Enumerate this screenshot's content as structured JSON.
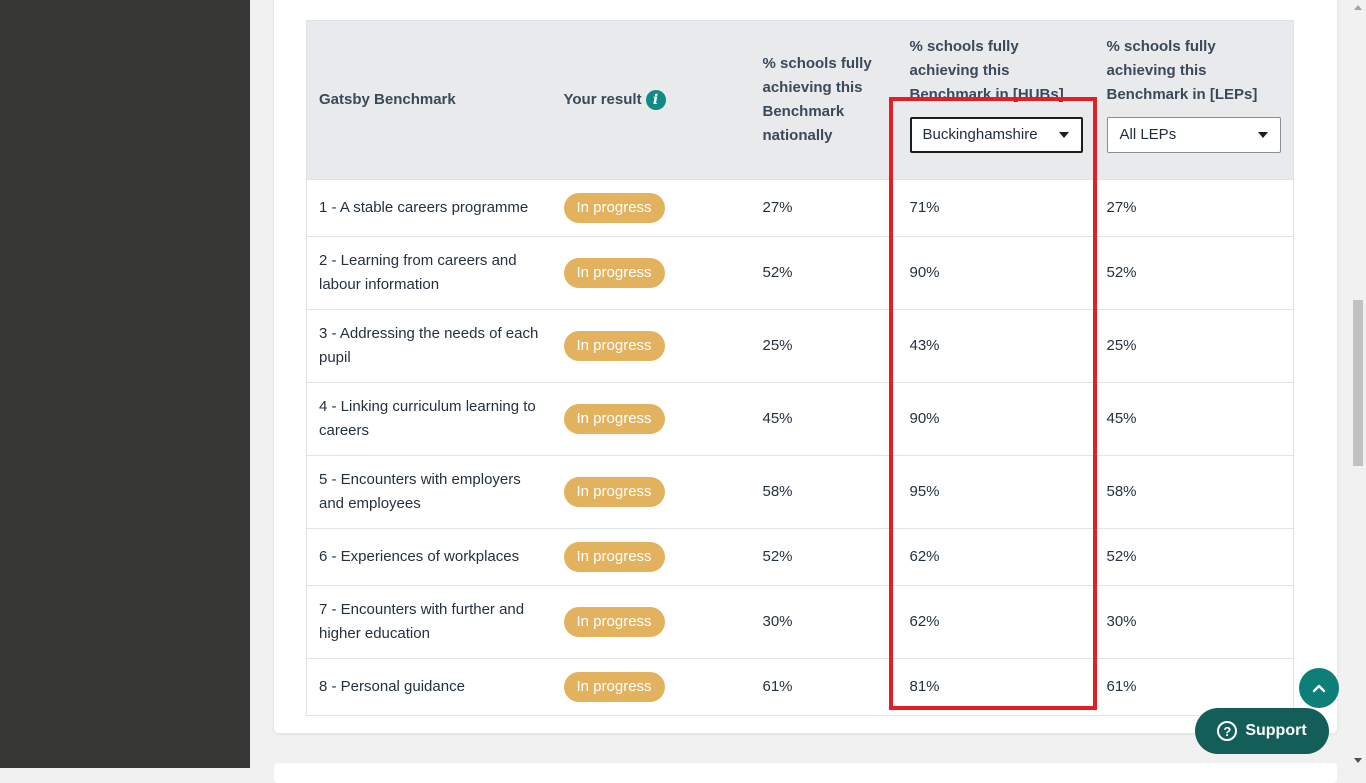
{
  "table": {
    "headers": {
      "benchmark": "Gatsby Benchmark",
      "result": "Your result",
      "national": "% schools fully achieving this Benchmark nationally",
      "hubs": "% schools fully achieving this Benchmark in [HUBs]",
      "leps": "% schools fully achieving this Benchmark in [LEPs]"
    },
    "hub_select_value": "Buckinghamshire",
    "lep_select_value": "All LEPs",
    "info_icon_glyph": "i",
    "rows": [
      {
        "benchmark": "1 - A stable careers programme",
        "result": "In progress",
        "national": "27%",
        "hub": "71%",
        "lep": "27%"
      },
      {
        "benchmark": "2 - Learning from careers and labour information",
        "result": "In progress",
        "national": "52%",
        "hub": "90%",
        "lep": "52%"
      },
      {
        "benchmark": "3 - Addressing the needs of each pupil",
        "result": "In progress",
        "national": "25%",
        "hub": "43%",
        "lep": "25%"
      },
      {
        "benchmark": "4 - Linking curriculum learning to careers",
        "result": "In progress",
        "national": "45%",
        "hub": "90%",
        "lep": "45%"
      },
      {
        "benchmark": "5 - Encounters with employers and employees",
        "result": "In progress",
        "national": "58%",
        "hub": "95%",
        "lep": "58%"
      },
      {
        "benchmark": "6 - Experiences of workplaces",
        "result": "In progress",
        "national": "52%",
        "hub": "62%",
        "lep": "52%"
      },
      {
        "benchmark": "7 - Encounters with further and higher education",
        "result": "In progress",
        "national": "30%",
        "hub": "62%",
        "lep": "30%"
      },
      {
        "benchmark": "8 - Personal guidance",
        "result": "In progress",
        "national": "61%",
        "hub": "81%",
        "lep": "61%"
      }
    ]
  },
  "buttons": {
    "support_label": "Support",
    "support_icon_glyph": "?"
  },
  "colors": {
    "badge": "#e3b25f",
    "accent_teal": "#0d7e78",
    "highlight_red": "#e41e26"
  },
  "icons": {
    "info": "info-icon",
    "back_to_top": "chevron-up-icon",
    "support": "question-circle-icon",
    "dropdown": "caret-down-icon"
  }
}
